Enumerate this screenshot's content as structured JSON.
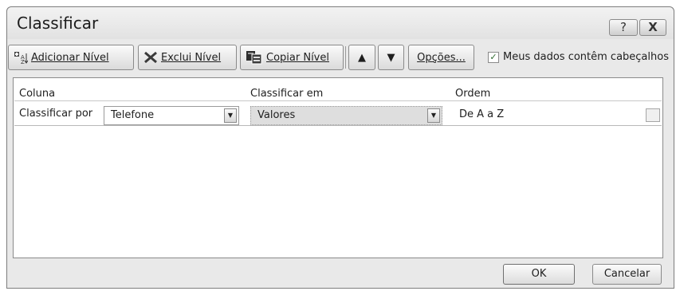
{
  "window": {
    "title": "Classificar",
    "help_glyph": "?",
    "close_glyph": "X"
  },
  "toolbar": {
    "add_level_label": "Adicionar Nível",
    "delete_level_label": "Exclui Nível",
    "copy_level_label": "Copiar Nível",
    "move_up_glyph": "▲",
    "move_down_glyph": "▼",
    "options_label": "Opções...",
    "header_checkbox_label": "Meus dados contêm cabeçalhos",
    "header_checkbox_checked": true,
    "check_glyph": "✓"
  },
  "table": {
    "headers": {
      "column": "Coluna",
      "sort_on": "Classificar em",
      "order": "Ordem"
    },
    "rows": [
      {
        "label": "Classificar por",
        "column_value": "Telefone",
        "sort_on_value": "Valores",
        "order_value": "De A a Z"
      }
    ]
  },
  "dropdown_glyph": "▼",
  "footer": {
    "ok_label": "OK",
    "cancel_label": "Cancelar"
  },
  "icons": {
    "add": "add-level-icon",
    "delete": "delete-x-icon",
    "copy": "copy-level-icon",
    "up": "arrow-up-icon",
    "down": "arrow-down-icon",
    "check": "checkmark-icon",
    "dropdown": "chevron-down-icon"
  }
}
